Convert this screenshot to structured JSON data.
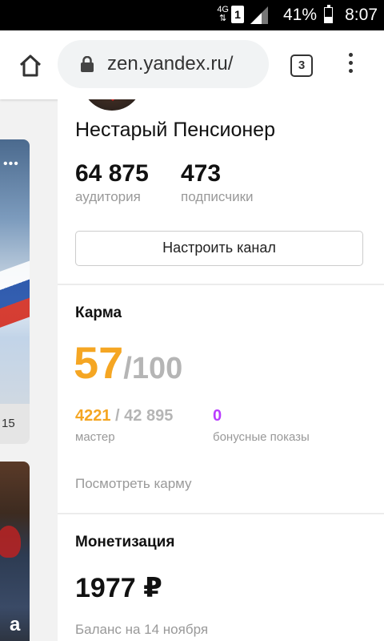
{
  "status_bar": {
    "network": "4G",
    "sim": "1",
    "battery_percent": "41%",
    "battery_level": 0.41,
    "time": "8:07"
  },
  "browser": {
    "url": "zen.yandex.ru/",
    "tab_count": "3"
  },
  "feed": {
    "card1_dots": "•••",
    "card1_count": "15",
    "card2_letter": "а"
  },
  "channel": {
    "name": "Нестарый Пенсионер",
    "audience_value": "64 875",
    "audience_label": "аудитория",
    "subscribers_value": "473",
    "subscribers_label": "подписчики",
    "settings_button": "Настроить канал"
  },
  "karma": {
    "title": "Карма",
    "score": "57",
    "score_total": "/100",
    "master_value": "4221",
    "master_total": " / 42 895",
    "master_label": "мастер",
    "bonus_value": "0",
    "bonus_label": "бонусные показы",
    "view_link": "Посмотреть карму"
  },
  "monetization": {
    "title": "Монетизация",
    "amount": "1977 ₽",
    "balance_label": "Баланс на 14 ноября"
  },
  "colors": {
    "accent_orange": "#f5a623",
    "accent_purple": "#b93cff",
    "muted_grey": "#999999"
  }
}
